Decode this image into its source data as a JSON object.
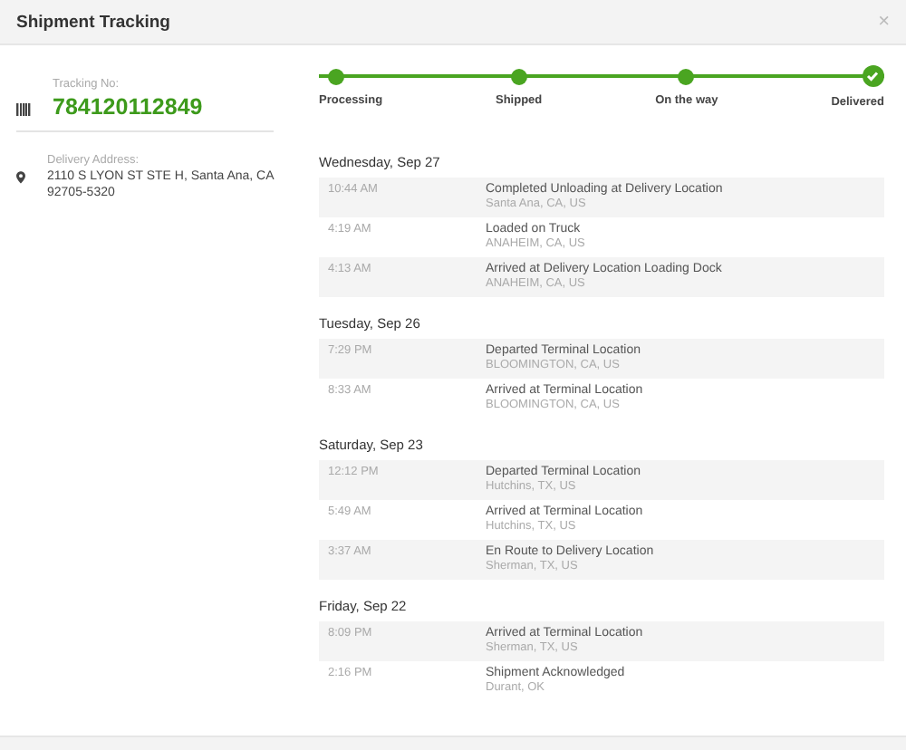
{
  "window": {
    "title": "Shipment Tracking",
    "close": "×"
  },
  "tracking": {
    "label": "Tracking No:",
    "number": "784120112849"
  },
  "delivery": {
    "label": "Delivery Address:",
    "address": "2110 S LYON ST STE H, Santa Ana, CA 92705-5320"
  },
  "stages": [
    {
      "label": "Processing",
      "done": true,
      "current": false
    },
    {
      "label": "Shipped",
      "done": true,
      "current": false
    },
    {
      "label": "On the way",
      "done": true,
      "current": false
    },
    {
      "label": "Delivered",
      "done": true,
      "current": true
    }
  ],
  "days": [
    {
      "date": "Wednesday, Sep 27",
      "events": [
        {
          "time": "10:44 AM",
          "status": "Completed Unloading at Delivery Location",
          "place": "Santa Ana, CA, US"
        },
        {
          "time": "4:19 AM",
          "status": "Loaded on Truck",
          "place": "ANAHEIM, CA, US"
        },
        {
          "time": "4:13 AM",
          "status": "Arrived at Delivery Location Loading Dock",
          "place": "ANAHEIM, CA, US"
        }
      ]
    },
    {
      "date": "Tuesday, Sep 26",
      "events": [
        {
          "time": "7:29 PM",
          "status": "Departed Terminal Location",
          "place": "BLOOMINGTON, CA, US"
        },
        {
          "time": "8:33 AM",
          "status": "Arrived at Terminal Location",
          "place": "BLOOMINGTON, CA, US"
        }
      ]
    },
    {
      "date": "Saturday, Sep 23",
      "events": [
        {
          "time": "12:12 PM",
          "status": "Departed Terminal Location",
          "place": "Hutchins, TX, US"
        },
        {
          "time": "5:49 AM",
          "status": "Arrived at Terminal Location",
          "place": "Hutchins, TX, US"
        },
        {
          "time": "3:37 AM",
          "status": "En Route to Delivery Location",
          "place": "Sherman, TX, US"
        }
      ]
    },
    {
      "date": "Friday, Sep 22",
      "events": [
        {
          "time": "8:09 PM",
          "status": "Arrived at Terminal Location",
          "place": "Sherman, TX, US"
        },
        {
          "time": "2:16 PM",
          "status": "Shipment Acknowledged",
          "place": "Durant, OK"
        }
      ]
    }
  ]
}
